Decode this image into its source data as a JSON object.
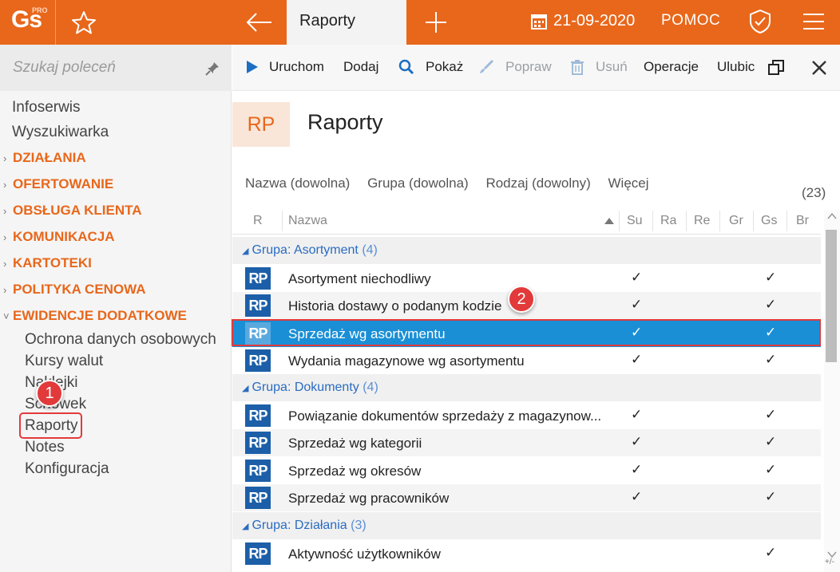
{
  "app": {
    "logo_text": "Gs",
    "logo_badge": "PRO",
    "active_tab": "Raporty",
    "date": "21-09-2020",
    "help": "POMOC"
  },
  "sidebar": {
    "search_placeholder": "Szukaj poleceń",
    "items": [
      "Infoserwis",
      "Wyszukiwarka"
    ],
    "sections": [
      "DZIAŁANIA",
      "OFERTOWANIE",
      "OBSŁUGA KLIENTA",
      "KOMUNIKACJA",
      "KARTOTEKI",
      "POLITYKA CENOWA",
      "EWIDENCJE DODATKOWE"
    ],
    "expanded_section_items": [
      "Ochrona danych osobowych",
      "Kursy walut",
      "Naklejki",
      "Schowek",
      "Raporty",
      "Notes",
      "Konfiguracja"
    ]
  },
  "toolbar": {
    "run": "Uruchom",
    "add": "Dodaj",
    "show": "Pokaż",
    "edit": "Popraw",
    "delete": "Usuń",
    "operations": "Operacje",
    "favorites": "Ulubic"
  },
  "header": {
    "badge": "RP",
    "title": "Raporty"
  },
  "filters": {
    "name": "Nazwa (dowolna)",
    "group": "Grupa (dowolna)",
    "kind": "Rodzaj (dowolny)",
    "more": "Więcej",
    "count": "(23)"
  },
  "grid": {
    "columns": [
      "R",
      "Nazwa",
      "Su",
      "Ra",
      "Re",
      "Gr",
      "Gs",
      "Br"
    ],
    "group_prefix": "Grupa:",
    "groups": [
      {
        "name": "Asortyment",
        "count": "(4)"
      },
      {
        "name": "Dokumenty",
        "count": "(4)"
      },
      {
        "name": "Działania",
        "count": "(3)"
      }
    ],
    "icon_text": "RP",
    "check": "✓",
    "rows": [
      "Asortyment niechodliwy",
      "Historia dostawy o podanym kodzie",
      "Sprzedaż wg asortymentu",
      "Wydania magazynowe wg asortymentu",
      "Powiązanie dokumentów sprzedaży z magazynow...",
      "Sprzedaż wg kategorii",
      "Sprzedaż wg okresów",
      "Sprzedaż wg pracowników",
      "Aktywność użytkowników"
    ],
    "plusminus": "+/-"
  },
  "annotations": {
    "step1": "1",
    "step2": "2"
  },
  "colors": {
    "accent": "#e8671b",
    "selection": "#1a8fd6",
    "marker": "#e23a3a"
  }
}
